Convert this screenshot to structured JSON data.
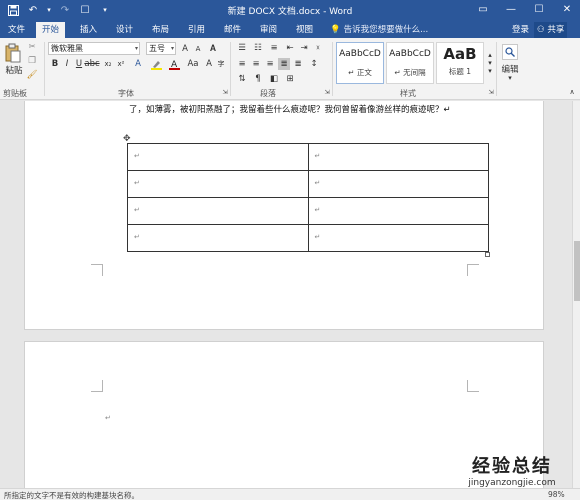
{
  "window": {
    "title": "新建 DOCX 文档.docx - Word",
    "qat_icons": [
      "save-icon",
      "undo-icon",
      "redo-icon",
      "touch-mode-icon",
      "customize-icon"
    ]
  },
  "tabs": [
    {
      "label": "文件"
    },
    {
      "label": "开始",
      "active": true
    },
    {
      "label": "插入"
    },
    {
      "label": "设计"
    },
    {
      "label": "布局"
    },
    {
      "label": "引用"
    },
    {
      "label": "邮件"
    },
    {
      "label": "审阅"
    },
    {
      "label": "视图"
    }
  ],
  "tell_me": "告诉我您想要做什么...",
  "sign_in": "登录",
  "share": "共享",
  "ribbon": {
    "paste_label": "粘贴",
    "clipboard_label": "剪贴板",
    "font_name": "微软雅黑",
    "font_size": "五号",
    "font_group_label": "字体",
    "paragraph_group_label": "段落",
    "styles_group_label": "样式",
    "editing_label": "编辑",
    "styles": [
      {
        "sample": "AaBbCcD",
        "name": "↵ 正文",
        "selected": true
      },
      {
        "sample": "AaBbCcD",
        "name": "↵ 无间隔"
      },
      {
        "sample": "AaB",
        "name": "标题 1"
      }
    ]
  },
  "document": {
    "text_line": "了，如薄雾，被初阳蒸融了；我留着些什么痕迹呢？我何曾留着像游丝样的痕迹呢？↵",
    "table": {
      "rows": 4,
      "cols": 2,
      "cell_mark": "↵"
    },
    "para_mark": "↵"
  },
  "status": {
    "message": "所指定的文字不是有效的构建基块名称。",
    "zoom": "98%"
  },
  "watermark": {
    "logo": "经验总结",
    "url": "jingyanzongjie.com"
  }
}
